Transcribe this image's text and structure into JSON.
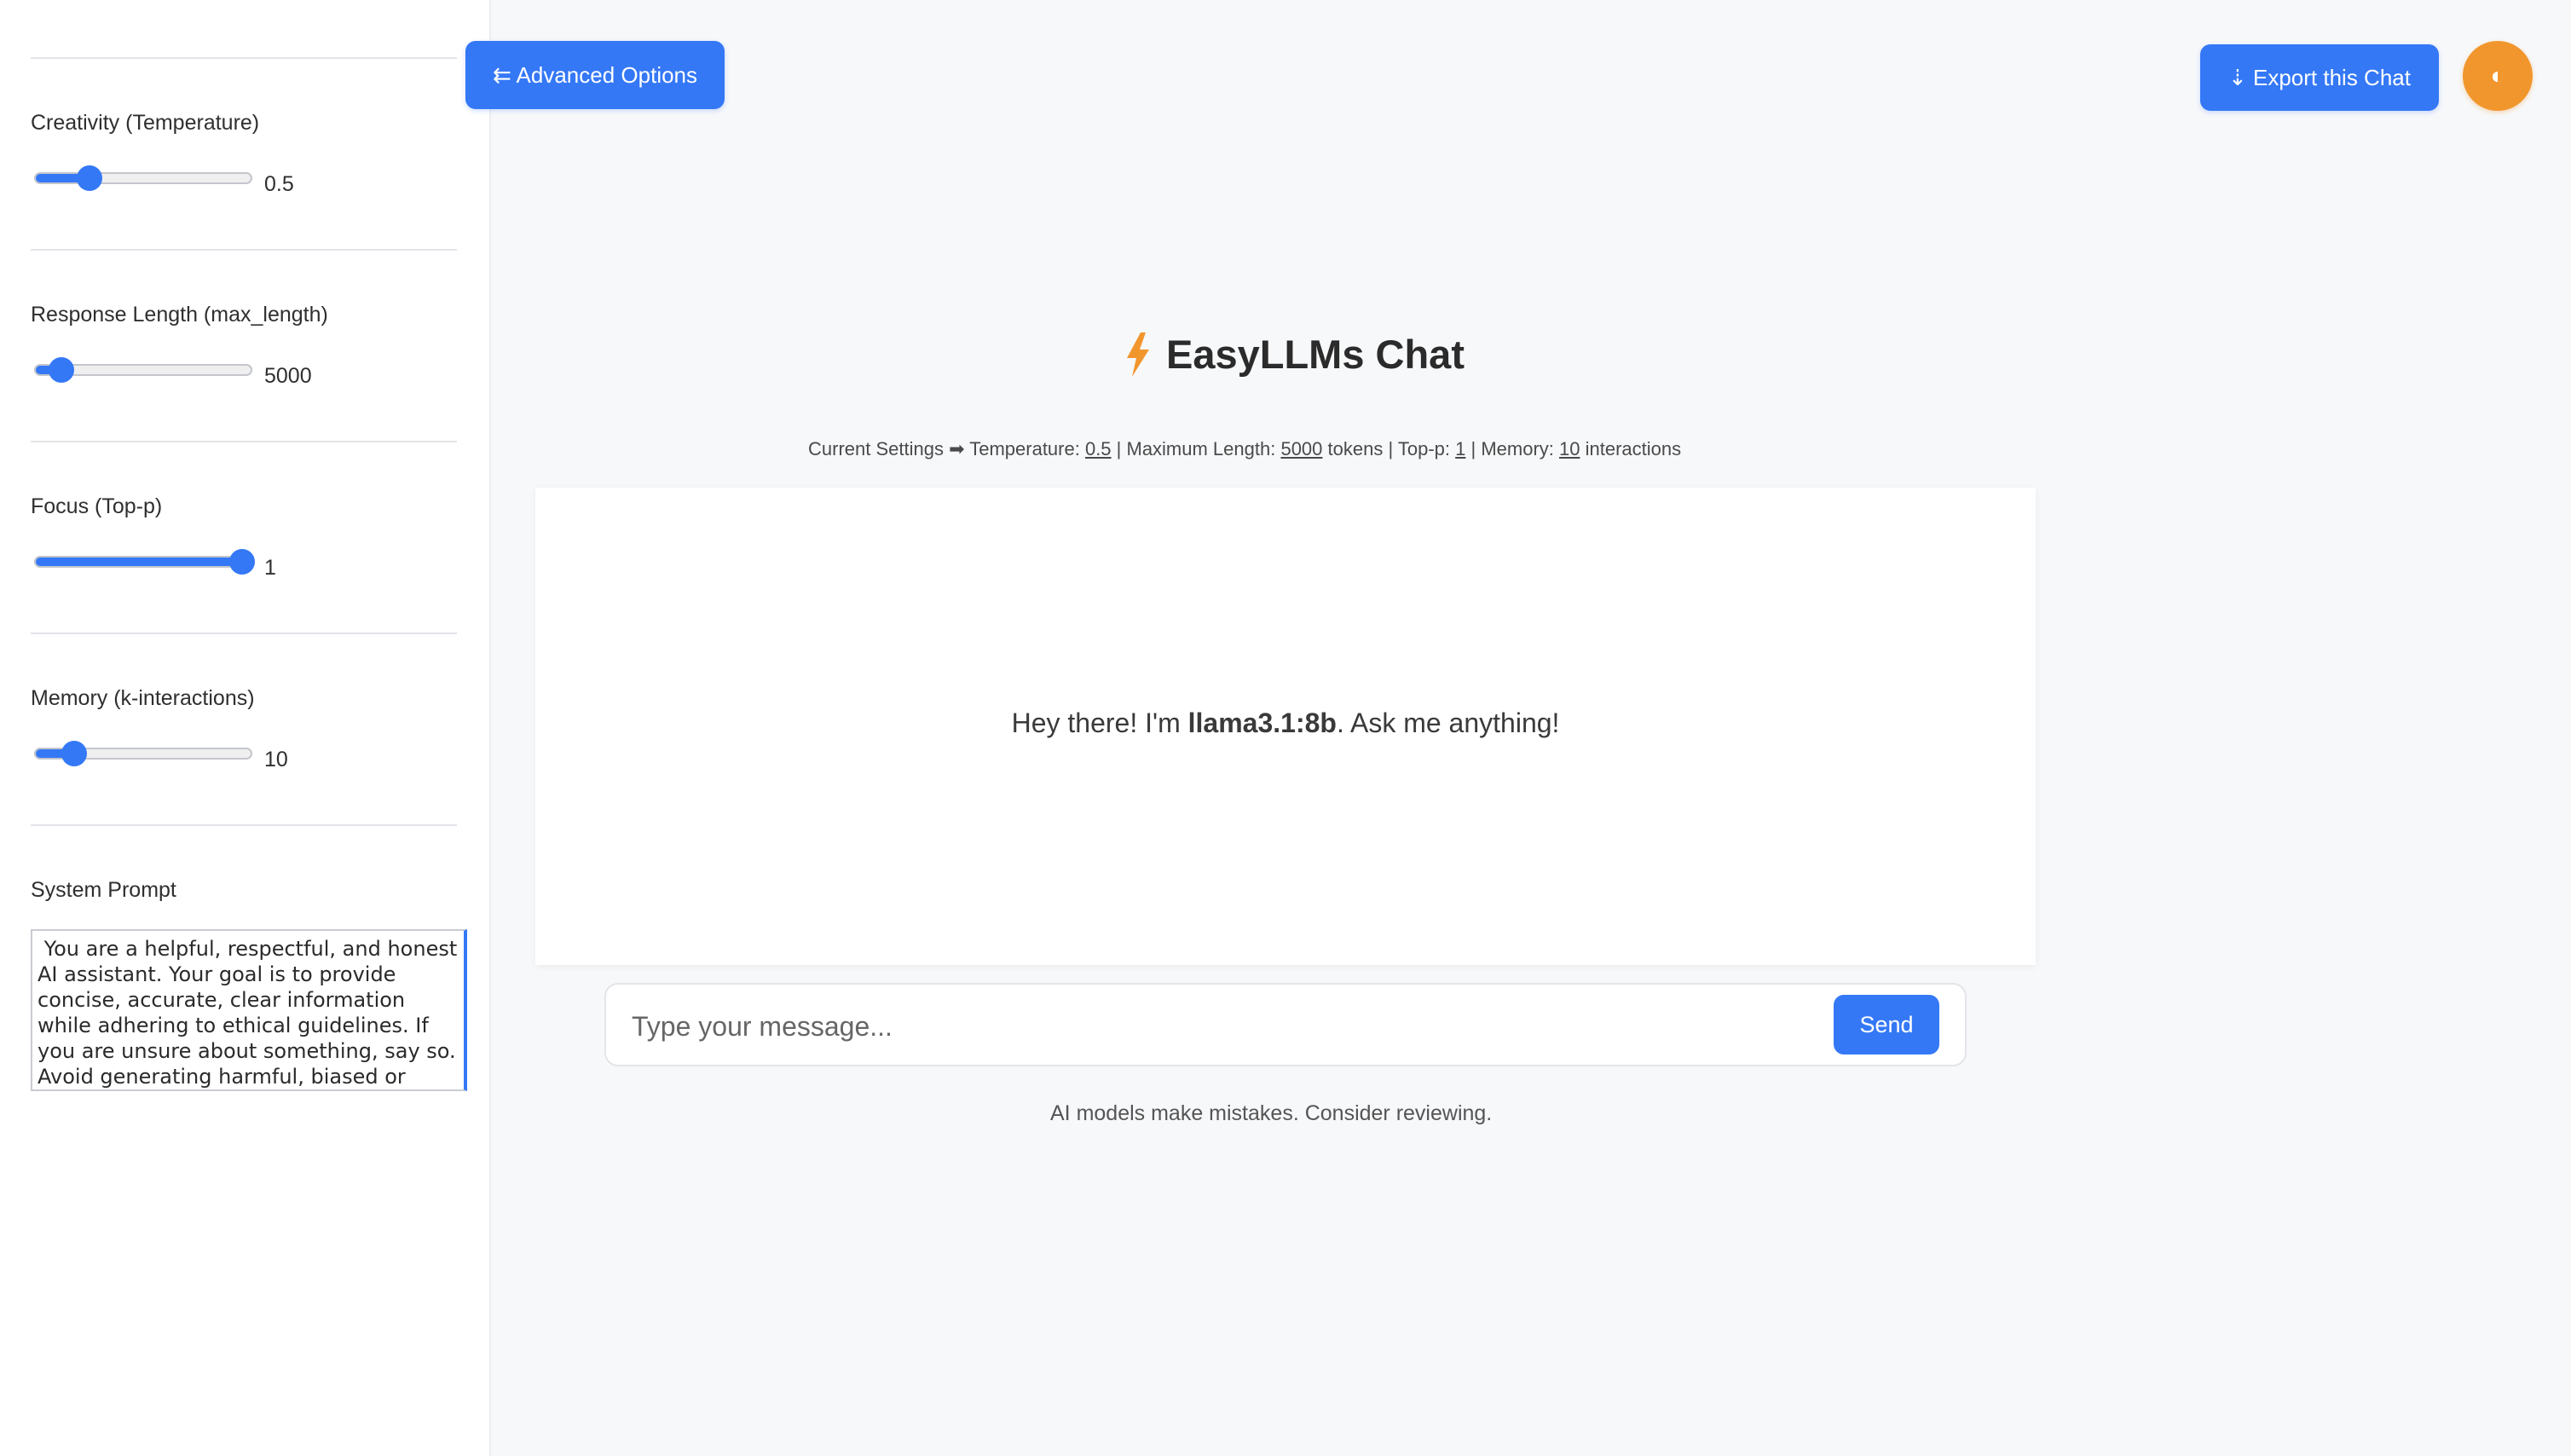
{
  "sidebar": {
    "controls": [
      {
        "label": "Creativity (Temperature)",
        "value": "0.5",
        "fraction": 0.25
      },
      {
        "label": "Response Length (max_length)",
        "value": "5000",
        "fraction": 0.12
      },
      {
        "label": "Focus (Top-p)",
        "value": "1",
        "fraction": 1.0
      },
      {
        "label": "Memory (k-interactions)",
        "value": "10",
        "fraction": 0.18
      }
    ],
    "system_prompt_label": "System Prompt",
    "system_prompt_value": " You are a helpful, respectful, and honest AI assistant. Your goal is to provide concise, accurate, clear information while adhering to ethical guidelines. If you are unsure about something, say so. Avoid generating harmful, biased or"
  },
  "header": {
    "advanced_options_label": "⇇ Advanced Options",
    "export_label": "⇣ Export this Chat",
    "theme_toggle_glyph": "◐"
  },
  "main": {
    "title": "EasyLLMs Chat",
    "settings": {
      "prefix": "Current Settings ➡ Temperature: ",
      "temperature": "0.5",
      "max_length_label": " | Maximum Length: ",
      "max_length": "5000",
      "tokens_label": " tokens | Top-p: ",
      "top_p": "1",
      "memory_label": " | Memory: ",
      "memory": "10",
      "interactions_label": " interactions"
    },
    "greeting": {
      "before": "Hey there! I'm ",
      "model": "llama3.1:8b",
      "after": ". Ask me anything!"
    },
    "input_placeholder": "Type your message...",
    "send_label": "Send",
    "disclaimer": "AI models make mistakes. Consider reviewing."
  },
  "colors": {
    "accent": "#3478f6",
    "theme_button": "#f1962d",
    "bolt": "#f1962d"
  }
}
